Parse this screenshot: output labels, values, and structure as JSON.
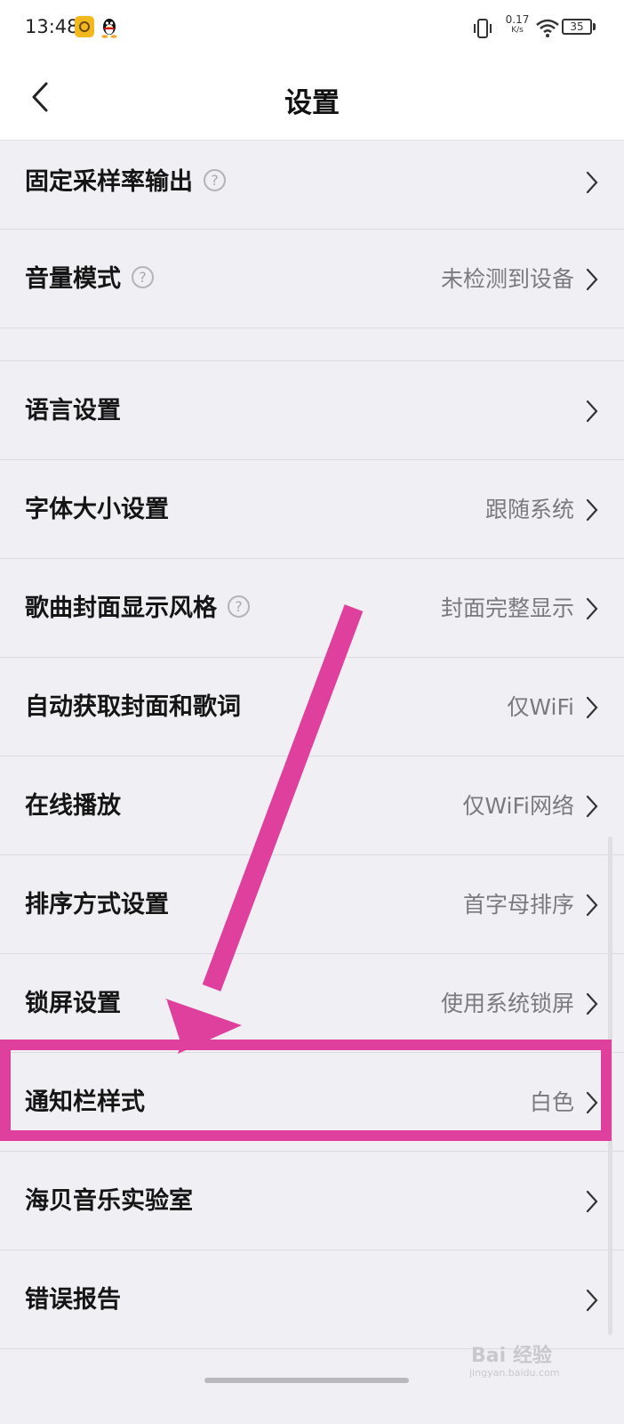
{
  "status_bar": {
    "time": "13:48",
    "net_speed_value": "0.17",
    "net_speed_unit": "K/s",
    "battery": "35"
  },
  "header": {
    "title": "设置"
  },
  "settings": {
    "items": [
      {
        "label": "固定采样率输出",
        "has_help": true,
        "value": ""
      },
      {
        "label": "音量模式",
        "has_help": true,
        "value": "未检测到设备"
      },
      {
        "label": "语言设置",
        "has_help": false,
        "value": ""
      },
      {
        "label": "字体大小设置",
        "has_help": false,
        "value": "跟随系统"
      },
      {
        "label": "歌曲封面显示风格",
        "has_help": true,
        "value": "封面完整显示"
      },
      {
        "label": "自动获取封面和歌词",
        "has_help": false,
        "value": "仅WiFi"
      },
      {
        "label": "在线播放",
        "has_help": false,
        "value": "仅WiFi网络"
      },
      {
        "label": "排序方式设置",
        "has_help": false,
        "value": "首字母排序"
      },
      {
        "label": "锁屏设置",
        "has_help": false,
        "value": "使用系统锁屏"
      },
      {
        "label": "通知栏样式",
        "has_help": false,
        "value": "白色",
        "highlighted": true
      },
      {
        "label": "海贝音乐实验室",
        "has_help": false,
        "value": ""
      },
      {
        "label": "错误报告",
        "has_help": false,
        "value": ""
      }
    ]
  },
  "help_glyph": "?",
  "annotation": {
    "color": "#e0409d"
  },
  "watermark": {
    "text": "Bai 经验",
    "url_text": "jingyan.baidu.com"
  },
  "colors": {
    "background": "#f0eff4",
    "label": "#151515",
    "value": "#7a7a7e"
  }
}
